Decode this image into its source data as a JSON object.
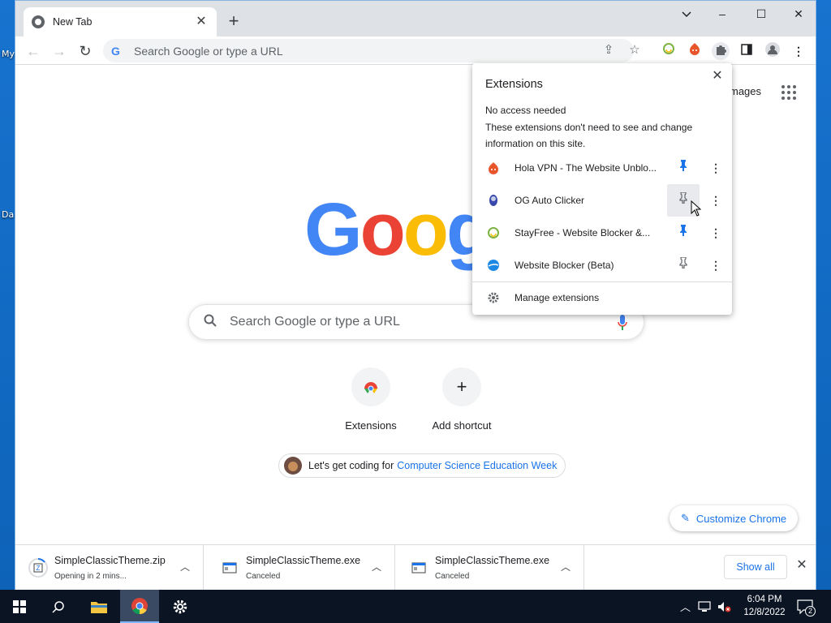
{
  "desktop": {
    "icon_labels": [
      "My",
      "Da"
    ]
  },
  "browser": {
    "tab_title": "New Tab",
    "omnibox_placeholder": "Search Google or type a URL",
    "window_controls": {
      "minimize": "–",
      "maximize": "☐",
      "close": "✕"
    }
  },
  "ntp": {
    "images_link": "mages",
    "logo_letters": [
      "G",
      "o",
      "o",
      "g"
    ],
    "logo_colors": [
      "#4285f4",
      "#ea4335",
      "#fbbc05",
      "#4285f4"
    ],
    "search_placeholder": "Search Google or type a URL",
    "shortcuts": [
      {
        "label": "Extensions"
      },
      {
        "label": "Add shortcut"
      }
    ],
    "promo_text": "Let's get coding for",
    "promo_link": "Computer Science Education Week",
    "customize_label": "Customize Chrome"
  },
  "extensions_popup": {
    "title": "Extensions",
    "section_title": "No access needed",
    "section_desc": "These extensions don't need to see and change information on this site.",
    "items": [
      {
        "name": "Hola VPN - The Website Unblo...",
        "pinned": true,
        "icon": "hola-icon",
        "icon_color": "#e8552b"
      },
      {
        "name": "OG Auto Clicker",
        "pinned": false,
        "icon": "og-clicker-icon",
        "icon_color": "#3949ab"
      },
      {
        "name": "StayFree - Website Blocker &...",
        "pinned": true,
        "icon": "stayfree-icon",
        "icon_color": "#7cb342"
      },
      {
        "name": "Website Blocker (Beta)",
        "pinned": false,
        "icon": "website-blocker-icon",
        "icon_color": "#1e88e5"
      }
    ],
    "manage_label": "Manage extensions"
  },
  "downloads": {
    "items": [
      {
        "name": "SimpleClassicTheme.zip",
        "status": "Opening in 2 mins..."
      },
      {
        "name": "SimpleClassicTheme.exe",
        "status": "Canceled"
      },
      {
        "name": "SimpleClassicTheme.exe",
        "status": "Canceled"
      }
    ],
    "show_all_label": "Show all"
  },
  "taskbar": {
    "time": "6:04 PM",
    "date": "12/8/2022",
    "notification_count": "2"
  },
  "colors": {
    "accent": "#1a73e8",
    "pin_active": "#1a73e8",
    "pin_inactive": "#5f6368"
  }
}
